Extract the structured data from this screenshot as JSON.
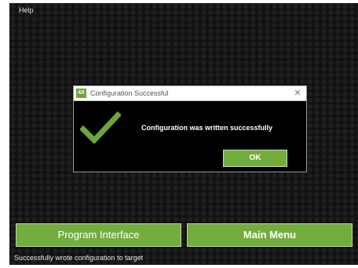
{
  "menubar": {
    "help_label": "Help"
  },
  "dialog": {
    "app_icon_label": "4X",
    "title": "Configuration Successful",
    "close_glyph": "✕",
    "message": "Configuration was written successfully",
    "ok_label": "OK",
    "icon": "checkmark-icon",
    "check_color": "#6fa63a"
  },
  "buttons": {
    "program_interface": "Program Interface",
    "main_menu": "Main Menu"
  },
  "status": {
    "text": "Successfully wrote configuration to target"
  },
  "colors": {
    "accent": "#72ad3e",
    "background": "#111111"
  }
}
